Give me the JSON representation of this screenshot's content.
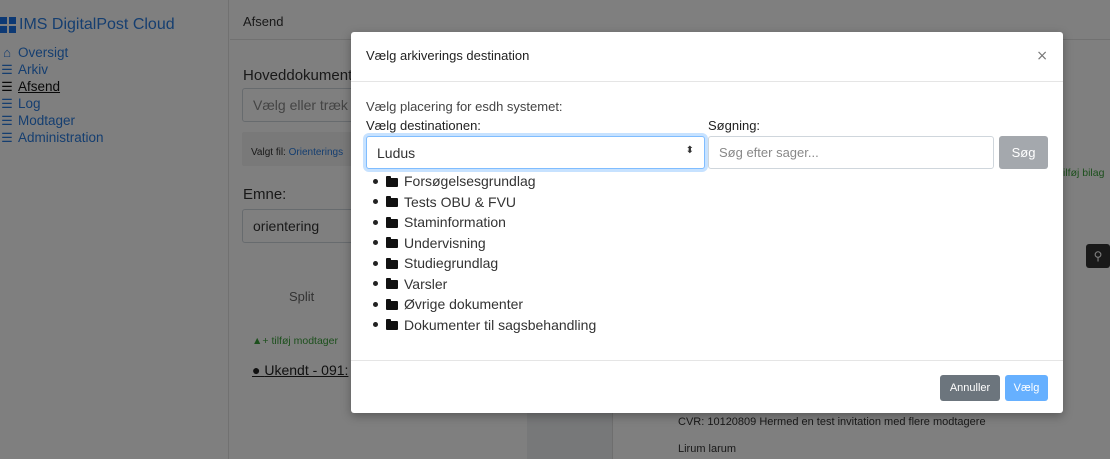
{
  "app": {
    "brand_title": "IMS DigitalPost Cloud",
    "brand_color": "#2a7de1"
  },
  "sidebar": {
    "items": [
      {
        "label": "Oversigt",
        "icon": "home-icon"
      },
      {
        "label": "Arkiv",
        "icon": "list-icon"
      },
      {
        "label": "Afsend",
        "icon": "list-icon",
        "active": true
      },
      {
        "label": "Log",
        "icon": "list-icon"
      },
      {
        "label": "Modtager",
        "icon": "list-icon"
      },
      {
        "label": "Administration",
        "icon": "list-icon"
      }
    ]
  },
  "topbar": {
    "title": "Afsend"
  },
  "background_form": {
    "main_document_label": "Hoveddokument",
    "file_input_placeholder": "Vælg eller træk",
    "selected_file_label": "Valgt fil:",
    "selected_file_name": "Orienterings",
    "subject_label": "Emne:",
    "subject_value": "orientering",
    "split_label": "Split",
    "add_recipient_label": "tilføj modtager",
    "recipient_label": "Ukendt - 091:",
    "add_attachment_label": "ilføj bilag",
    "doc_line_1": "CVR: 10120809 Hermed en test invitation med flere modtagere",
    "doc_line_2": "Lirum larum"
  },
  "modal": {
    "title": "Vælg arkiverings destination",
    "close_symbol": "×",
    "intro": "Vælg placering for esdh systemet:",
    "destination_label": "Vælg destinationen:",
    "search_label": "Søgning:",
    "selected_destination": "Ludus",
    "caret_symbol": "⬍",
    "search_placeholder": "Søg efter sager...",
    "search_button": "Søg",
    "folders": [
      "Forsøgelsesgrundlag",
      "Tests OBU & FVU",
      "Staminformation",
      "Undervisning",
      "Studiegrundlag",
      "Varsler",
      "Øvrige dokumenter",
      "Dokumenter til sagsbehandling"
    ],
    "cancel_button": "Annuller",
    "select_button": "Vælg",
    "colors": {
      "cancel": "#6c757d",
      "select": "#66b0ff",
      "search": "#a4a8ad",
      "focus_border": "#80bdff"
    }
  }
}
